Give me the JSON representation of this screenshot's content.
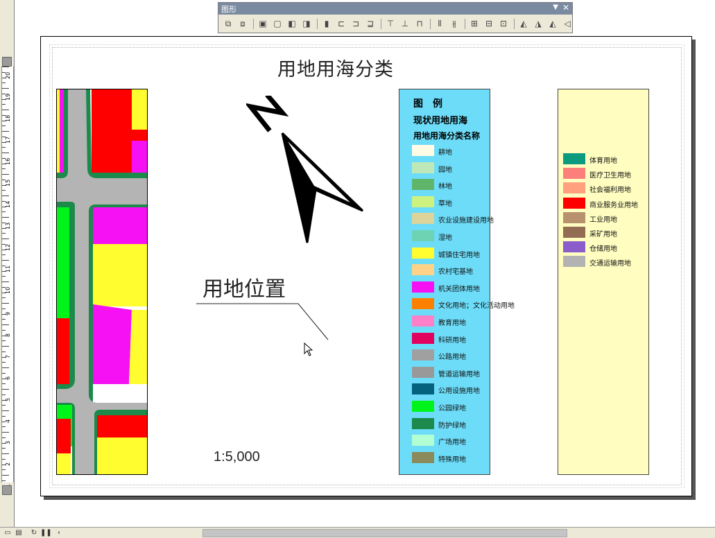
{
  "toolbar": {
    "title": "图形",
    "dropdown_glyph": "▼",
    "close_glyph": "✕",
    "icons": [
      "group-icon",
      "ungroup-icon",
      "bring-to-front-icon",
      "send-to-back-icon",
      "bring-forward-icon",
      "send-backward-icon",
      "align-left-edge-icon",
      "align-left-icon",
      "align-center-icon",
      "align-right-icon",
      "align-top-icon",
      "align-middle-icon",
      "align-bottom-icon",
      "distribute-horizontal-icon",
      "distribute-vertical-icon",
      "make-same-size-icon",
      "make-same-width-icon",
      "make-same-height-icon",
      "rotate-left-icon",
      "rotate-right-icon",
      "flip-horizontal-icon",
      "flip-vertical-icon"
    ]
  },
  "ruler": {
    "labels": [
      "20",
      "19",
      "18",
      "17",
      "16",
      "15",
      "14",
      "13",
      "12",
      "11",
      "10",
      "9",
      "8",
      "7",
      "6",
      "5",
      "4",
      "3",
      "2",
      "1"
    ]
  },
  "layout": {
    "map_title": "用地用海分类",
    "location_label": "用地位置",
    "scale_text": "1:5,000",
    "north_label": "N"
  },
  "legend": {
    "title": "图例",
    "subtitle": "现状用地用海",
    "category_header": "用地用海分类名称",
    "items": [
      {
        "label": "耕地",
        "color": "#fffbe4"
      },
      {
        "label": "园地",
        "color": "#bfe8b8"
      },
      {
        "label": "林地",
        "color": "#5fb56a"
      },
      {
        "label": "草地",
        "color": "#cdf27f"
      },
      {
        "label": "农业设施建设用地",
        "color": "#dcd49a"
      },
      {
        "label": "湿地",
        "color": "#6ed3b2"
      },
      {
        "label": "城镇住宅用地",
        "color": "#fffc30"
      },
      {
        "label": "农村宅基地",
        "color": "#ffd387"
      },
      {
        "label": "机关团体用地",
        "color": "#f610f4"
      },
      {
        "label": "文化用地；文化活动用地",
        "color": "#ff7f00"
      },
      {
        "label": "教育用地",
        "color": "#ff80c8"
      },
      {
        "label": "科研用地",
        "color": "#e2005f"
      },
      {
        "label": "公路用地",
        "color": "#a0a0a0"
      },
      {
        "label": "管道运输用地",
        "color": "#999999"
      },
      {
        "label": "公用设施用地",
        "color": "#04627f"
      },
      {
        "label": "公园绿地",
        "color": "#00f41a"
      },
      {
        "label": "防护绿地",
        "color": "#1b8a4a"
      },
      {
        "label": "广场用地",
        "color": "#b2ffd3"
      },
      {
        "label": "特殊用地",
        "color": "#8a8a5a"
      }
    ],
    "items2": [
      {
        "label": "体育用地",
        "color": "#0d9b7f"
      },
      {
        "label": "医疗卫生用地",
        "color": "#fc7f7c"
      },
      {
        "label": "社会福利用地",
        "color": "#ffa07f"
      },
      {
        "label": "商业服务业用地",
        "color": "#ff0000"
      },
      {
        "label": "工业用地",
        "color": "#b8926f"
      },
      {
        "label": "采矿用地",
        "color": "#936c54"
      },
      {
        "label": "仓储用地",
        "color": "#8b5dcb"
      },
      {
        "label": "交通运输用地",
        "color": "#b3b3b3"
      }
    ]
  },
  "map_colors": {
    "road": "#b4b4b4",
    "road_edge": "#1b8a4a",
    "commercial": "#ff0000",
    "residential": "#fffc30",
    "institution": "#f610f4",
    "park": "#00f41a"
  }
}
